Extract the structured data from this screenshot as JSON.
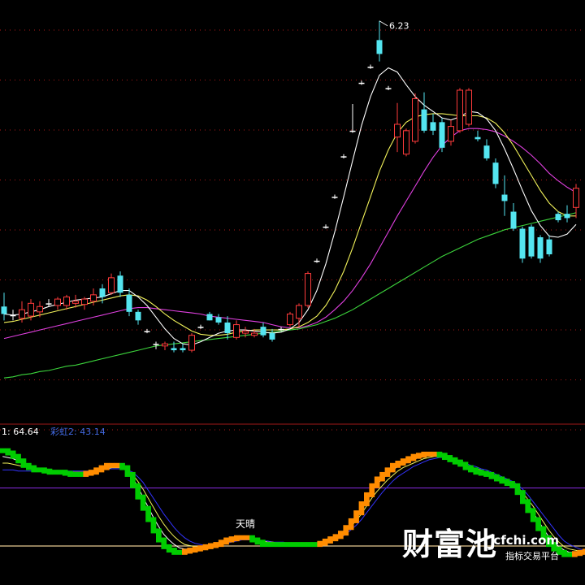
{
  "chart_data": [
    {
      "type": "candlestick",
      "title": "",
      "peak_label": "6.23",
      "ylim": [
        2.5,
        6.35
      ],
      "colors": {
        "up": "#ff3b3b",
        "down": "#54e5f0",
        "flat": "#ffffff",
        "ma_white": "#ffffff",
        "ma_yellow": "#f2f25a",
        "ma_magenta": "#e040e0",
        "ma_green": "#3cd43c",
        "grid": "#b01818"
      },
      "candles": [
        {
          "o": 3.55,
          "h": 3.68,
          "l": 3.42,
          "c": 3.48
        },
        {
          "o": 3.47,
          "h": 3.52,
          "l": 3.42,
          "c": 3.47
        },
        {
          "o": 3.44,
          "h": 3.6,
          "l": 3.4,
          "c": 3.52
        },
        {
          "o": 3.46,
          "h": 3.62,
          "l": 3.42,
          "c": 3.58
        },
        {
          "o": 3.5,
          "h": 3.6,
          "l": 3.45,
          "c": 3.55
        },
        {
          "o": 3.58,
          "h": 3.62,
          "l": 3.55,
          "c": 3.58
        },
        {
          "o": 3.56,
          "h": 3.64,
          "l": 3.52,
          "c": 3.62
        },
        {
          "o": 3.56,
          "h": 3.66,
          "l": 3.52,
          "c": 3.64
        },
        {
          "o": 3.58,
          "h": 3.66,
          "l": 3.54,
          "c": 3.6
        },
        {
          "o": 3.57,
          "h": 3.64,
          "l": 3.52,
          "c": 3.62
        },
        {
          "o": 3.6,
          "h": 3.72,
          "l": 3.56,
          "c": 3.66
        },
        {
          "o": 3.72,
          "h": 3.76,
          "l": 3.58,
          "c": 3.64
        },
        {
          "o": 3.68,
          "h": 3.86,
          "l": 3.66,
          "c": 3.82
        },
        {
          "o": 3.84,
          "h": 3.88,
          "l": 3.64,
          "c": 3.68
        },
        {
          "o": 3.66,
          "h": 3.72,
          "l": 3.46,
          "c": 3.5
        },
        {
          "o": 3.5,
          "h": 3.52,
          "l": 3.38,
          "c": 3.42
        },
        {
          "o": 3.32,
          "h": 3.34,
          "l": 3.3,
          "c": 3.32
        },
        {
          "o": 3.2,
          "h": 3.22,
          "l": 3.15,
          "c": 3.2
        },
        {
          "o": 3.18,
          "h": 3.22,
          "l": 3.14,
          "c": 3.2
        },
        {
          "o": 3.16,
          "h": 3.22,
          "l": 3.12,
          "c": 3.14
        },
        {
          "o": 3.16,
          "h": 3.2,
          "l": 3.12,
          "c": 3.14
        },
        {
          "o": 3.14,
          "h": 3.3,
          "l": 3.12,
          "c": 3.28
        },
        {
          "o": 3.36,
          "h": 3.38,
          "l": 3.34,
          "c": 3.36
        },
        {
          "o": 3.48,
          "h": 3.5,
          "l": 3.42,
          "c": 3.42
        },
        {
          "o": 3.45,
          "h": 3.48,
          "l": 3.38,
          "c": 3.4
        },
        {
          "o": 3.4,
          "h": 3.46,
          "l": 3.24,
          "c": 3.3
        },
        {
          "o": 3.26,
          "h": 3.42,
          "l": 3.24,
          "c": 3.38
        },
        {
          "o": 3.3,
          "h": 3.36,
          "l": 3.26,
          "c": 3.32
        },
        {
          "o": 3.28,
          "h": 3.34,
          "l": 3.26,
          "c": 3.3
        },
        {
          "o": 3.36,
          "h": 3.4,
          "l": 3.26,
          "c": 3.28
        },
        {
          "o": 3.3,
          "h": 3.34,
          "l": 3.22,
          "c": 3.24
        },
        {
          "o": 3.34,
          "h": 3.36,
          "l": 3.32,
          "c": 3.34
        },
        {
          "o": 3.38,
          "h": 3.5,
          "l": 3.36,
          "c": 3.48
        },
        {
          "o": 3.44,
          "h": 3.58,
          "l": 3.36,
          "c": 3.56
        },
        {
          "o": 3.56,
          "h": 3.88,
          "l": 3.54,
          "c": 3.86
        },
        {
          "o": 3.98,
          "h": 4.0,
          "l": 3.96,
          "c": 3.98
        },
        {
          "o": 4.3,
          "h": 4.32,
          "l": 4.28,
          "c": 4.3
        },
        {
          "o": 4.58,
          "h": 4.6,
          "l": 4.56,
          "c": 4.58
        },
        {
          "o": 4.96,
          "h": 4.98,
          "l": 4.94,
          "c": 4.96
        },
        {
          "o": 5.2,
          "h": 5.45,
          "l": 5.18,
          "c": 5.2
        },
        {
          "o": 5.65,
          "h": 5.67,
          "l": 5.63,
          "c": 5.65
        },
        {
          "o": 5.8,
          "h": 5.82,
          "l": 5.78,
          "c": 5.8
        },
        {
          "o": 6.05,
          "h": 6.23,
          "l": 5.85,
          "c": 5.92
        },
        {
          "o": 5.6,
          "h": 5.62,
          "l": 5.58,
          "c": 5.6
        },
        {
          "o": 5.14,
          "h": 5.46,
          "l": 5.0,
          "c": 5.26
        },
        {
          "o": 4.98,
          "h": 5.22,
          "l": 4.96,
          "c": 5.2
        },
        {
          "o": 5.1,
          "h": 5.55,
          "l": 5.08,
          "c": 5.5
        },
        {
          "o": 5.4,
          "h": 5.56,
          "l": 5.18,
          "c": 5.2
        },
        {
          "o": 5.28,
          "h": 5.36,
          "l": 5.16,
          "c": 5.2
        },
        {
          "o": 5.28,
          "h": 5.32,
          "l": 5.0,
          "c": 5.04
        },
        {
          "o": 5.1,
          "h": 5.3,
          "l": 5.06,
          "c": 5.24
        },
        {
          "o": 5.2,
          "h": 5.6,
          "l": 5.18,
          "c": 5.58
        },
        {
          "o": 5.26,
          "h": 5.6,
          "l": 5.24,
          "c": 5.58
        },
        {
          "o": 5.14,
          "h": 5.2,
          "l": 5.1,
          "c": 5.12
        },
        {
          "o": 5.06,
          "h": 5.12,
          "l": 4.92,
          "c": 4.94
        },
        {
          "o": 4.9,
          "h": 4.94,
          "l": 4.66,
          "c": 4.7
        },
        {
          "o": 4.6,
          "h": 4.78,
          "l": 4.4,
          "c": 4.54
        },
        {
          "o": 4.44,
          "h": 4.52,
          "l": 4.26,
          "c": 4.28
        },
        {
          "o": 4.28,
          "h": 4.3,
          "l": 3.96,
          "c": 4.0
        },
        {
          "o": 4.3,
          "h": 4.32,
          "l": 4.0,
          "c": 4.02
        },
        {
          "o": 4.2,
          "h": 4.22,
          "l": 3.96,
          "c": 4.0
        },
        {
          "o": 4.18,
          "h": 4.22,
          "l": 4.02,
          "c": 4.04
        },
        {
          "o": 4.42,
          "h": 4.44,
          "l": 4.34,
          "c": 4.36
        },
        {
          "o": 4.42,
          "h": 4.5,
          "l": 4.34,
          "c": 4.38
        },
        {
          "o": 4.48,
          "h": 4.7,
          "l": 4.38,
          "c": 4.66
        }
      ],
      "ma_white": [
        3.48,
        3.47,
        3.48,
        3.5,
        3.52,
        3.55,
        3.57,
        3.59,
        3.61,
        3.62,
        3.63,
        3.64,
        3.67,
        3.7,
        3.7,
        3.64,
        3.56,
        3.45,
        3.34,
        3.25,
        3.2,
        3.19,
        3.22,
        3.26,
        3.3,
        3.32,
        3.33,
        3.33,
        3.32,
        3.31,
        3.3,
        3.31,
        3.34,
        3.4,
        3.52,
        3.7,
        3.95,
        4.25,
        4.58,
        4.92,
        5.25,
        5.52,
        5.72,
        5.79,
        5.75,
        5.63,
        5.52,
        5.44,
        5.38,
        5.32,
        5.3,
        5.33,
        5.38,
        5.37,
        5.31,
        5.2,
        5.03,
        4.84,
        4.64,
        4.45,
        4.31,
        4.21,
        4.2,
        4.23,
        4.32
      ],
      "ma_yellow": [
        3.4,
        3.41,
        3.43,
        3.45,
        3.47,
        3.49,
        3.51,
        3.53,
        3.55,
        3.57,
        3.59,
        3.61,
        3.63,
        3.65,
        3.66,
        3.65,
        3.61,
        3.55,
        3.48,
        3.42,
        3.37,
        3.32,
        3.29,
        3.28,
        3.28,
        3.29,
        3.31,
        3.32,
        3.33,
        3.33,
        3.33,
        3.33,
        3.34,
        3.36,
        3.4,
        3.46,
        3.56,
        3.7,
        3.88,
        4.1,
        4.34,
        4.58,
        4.82,
        5.02,
        5.18,
        5.28,
        5.33,
        5.35,
        5.36,
        5.36,
        5.35,
        5.34,
        5.34,
        5.34,
        5.32,
        5.27,
        5.18,
        5.06,
        4.92,
        4.78,
        4.64,
        4.52,
        4.44,
        4.4,
        4.4
      ],
      "ma_magenta": [
        3.25,
        3.27,
        3.29,
        3.31,
        3.33,
        3.35,
        3.37,
        3.39,
        3.41,
        3.43,
        3.45,
        3.47,
        3.49,
        3.51,
        3.53,
        3.54,
        3.54,
        3.53,
        3.52,
        3.51,
        3.5,
        3.49,
        3.48,
        3.46,
        3.45,
        3.44,
        3.43,
        3.42,
        3.41,
        3.4,
        3.38,
        3.36,
        3.35,
        3.35,
        3.37,
        3.4,
        3.45,
        3.52,
        3.6,
        3.7,
        3.82,
        3.95,
        4.1,
        4.25,
        4.4,
        4.54,
        4.68,
        4.82,
        4.95,
        5.06,
        5.14,
        5.2,
        5.22,
        5.22,
        5.21,
        5.19,
        5.15,
        5.1,
        5.04,
        4.97,
        4.89,
        4.8,
        4.73,
        4.67,
        4.62
      ],
      "ma_green": [
        2.88,
        2.89,
        2.91,
        2.92,
        2.94,
        2.95,
        2.97,
        2.99,
        3.0,
        3.02,
        3.04,
        3.06,
        3.08,
        3.1,
        3.12,
        3.14,
        3.16,
        3.18,
        3.19,
        3.2,
        3.21,
        3.22,
        3.23,
        3.24,
        3.25,
        3.26,
        3.27,
        3.28,
        3.29,
        3.3,
        3.31,
        3.32,
        3.33,
        3.34,
        3.36,
        3.38,
        3.41,
        3.44,
        3.48,
        3.52,
        3.57,
        3.62,
        3.67,
        3.72,
        3.77,
        3.82,
        3.87,
        3.92,
        3.97,
        4.02,
        4.06,
        4.1,
        4.14,
        4.18,
        4.21,
        4.24,
        4.27,
        4.29,
        4.31,
        4.33,
        4.35,
        4.37,
        4.39,
        4.41,
        4.43
      ]
    },
    {
      "type": "bar",
      "title": "",
      "label_1": "1: 64.64",
      "label_2": "彩虹2: 43.14",
      "annotation": "天晴",
      "ylim": [
        0,
        100
      ],
      "ref_upper": 60,
      "ref_lower": 0,
      "colors": {
        "rise": "#ff8c00",
        "fall": "#00cc00",
        "line1": "#ffffff",
        "line2": "#f2f25a",
        "line3": "#3333ff",
        "ref_upper": "#8a2be2",
        "ref_lower": "#e6c890",
        "label_1": "#ffffff",
        "label_2": "#4169e1",
        "annotation": "#ffffff"
      },
      "values": [
        93,
        91,
        88,
        84,
        80,
        78,
        76,
        76,
        75,
        74,
        74,
        74,
        73,
        72,
        72,
        72,
        73,
        74,
        76,
        78,
        80,
        80,
        80,
        78,
        72,
        62,
        52,
        42,
        32,
        22,
        14,
        8,
        5,
        3,
        3,
        4,
        5,
        6,
        7,
        8,
        9,
        10,
        12,
        14,
        15,
        16,
        16,
        16,
        14,
        12,
        10,
        10,
        10,
        10,
        10,
        10,
        10,
        10,
        10,
        10,
        10,
        11,
        13,
        15,
        17,
        20,
        25,
        31,
        38,
        46,
        54,
        62,
        68,
        72,
        76,
        80,
        82,
        84,
        86,
        88,
        89,
        90,
        90,
        90,
        89,
        87,
        85,
        83,
        81,
        78,
        76,
        74,
        73,
        72,
        70,
        68,
        66,
        64,
        62,
        56,
        48,
        40,
        32,
        24,
        16,
        10,
        6,
        3,
        1,
        1,
        2,
        3,
        4,
        5
      ],
      "line1": [
        88,
        87,
        86,
        84,
        82,
        80,
        78,
        77,
        76,
        75,
        75,
        74,
        74,
        73,
        73,
        73,
        73,
        74,
        75,
        77,
        78,
        79,
        79,
        78,
        75,
        69,
        61,
        52,
        43,
        34,
        26,
        19,
        14,
        10,
        7,
        6,
        6,
        6,
        7,
        8,
        9,
        10,
        11,
        13,
        14,
        15,
        16,
        16,
        15,
        13,
        12,
        11,
        11,
        10,
        10,
        10,
        10,
        10,
        10,
        10,
        10,
        11,
        12,
        14,
        16,
        19,
        23,
        29,
        35,
        42,
        50,
        57,
        63,
        68,
        72,
        76,
        79,
        81,
        83,
        85,
        87,
        88,
        89,
        89,
        89,
        88,
        86,
        84,
        82,
        80,
        78,
        76,
        74,
        73,
        71,
        69,
        67,
        65,
        63,
        59,
        53,
        46,
        39,
        31,
        24,
        17,
        12,
        8,
        5,
        3,
        3,
        3,
        4,
        5
      ],
      "line2": [
        82,
        82,
        81,
        80,
        79,
        78,
        77,
        76,
        76,
        75,
        75,
        75,
        74,
        74,
        74,
        74,
        74,
        74,
        75,
        76,
        77,
        78,
        78,
        78,
        76,
        72,
        66,
        59,
        51,
        43,
        35,
        28,
        22,
        17,
        13,
        10,
        9,
        8,
        8,
        8,
        9,
        10,
        11,
        12,
        13,
        14,
        15,
        15,
        15,
        14,
        13,
        12,
        12,
        11,
        11,
        11,
        11,
        10,
        10,
        10,
        10,
        11,
        12,
        13,
        15,
        17,
        21,
        26,
        31,
        37,
        44,
        51,
        57,
        62,
        67,
        71,
        75,
        78,
        80,
        82,
        84,
        86,
        87,
        88,
        88,
        87,
        86,
        85,
        83,
        81,
        79,
        77,
        76,
        74,
        72,
        70,
        68,
        66,
        64,
        61,
        56,
        50,
        44,
        37,
        30,
        23,
        17,
        12,
        8,
        6,
        5,
        4,
        4,
        5
      ],
      "line3": [
        76,
        76,
        76,
        75,
        75,
        75,
        75,
        75,
        75,
        75,
        75,
        75,
        75,
        75,
        75,
        75,
        75,
        75,
        76,
        76,
        77,
        77,
        77,
        77,
        76,
        74,
        70,
        65,
        58,
        51,
        44,
        37,
        31,
        25,
        20,
        16,
        13,
        11,
        10,
        9,
        9,
        10,
        10,
        11,
        12,
        13,
        14,
        14,
        14,
        14,
        13,
        13,
        12,
        12,
        12,
        11,
        11,
        11,
        11,
        11,
        11,
        11,
        12,
        13,
        14,
        16,
        19,
        23,
        27,
        32,
        38,
        44,
        50,
        56,
        61,
        66,
        70,
        73,
        76,
        79,
        81,
        83,
        85,
        86,
        87,
        87,
        86,
        85,
        84,
        82,
        80,
        79,
        77,
        76,
        74,
        72,
        70,
        68,
        66,
        63,
        59,
        54,
        48,
        42,
        36,
        30,
        24,
        18,
        13,
        10,
        8,
        6,
        5,
        5
      ]
    }
  ],
  "watermark": {
    "brand": "财富池",
    "site": "cfchi.com",
    "tagline": "指标交易平台"
  }
}
